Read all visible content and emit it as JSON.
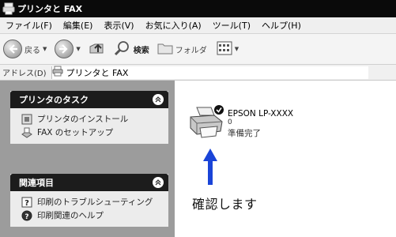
{
  "window": {
    "title": "プリンタと FAX"
  },
  "menubar": {
    "items": [
      "ファイル(F)",
      "編集(E)",
      "表示(V)",
      "お気に入り(A)",
      "ツール(T)",
      "ヘルプ(H)"
    ]
  },
  "toolbar": {
    "back_label": "戻る",
    "search_label": "検索",
    "folders_label": "フォルダ"
  },
  "address": {
    "label": "アドレス(D)",
    "value": "プリンタと FAX"
  },
  "sidebar": {
    "printer_tasks": {
      "title": "プリンタのタスク",
      "items": [
        {
          "label": "プリンタのインストール",
          "icon": "printer-install-icon"
        },
        {
          "label": "FAX のセットアップ",
          "icon": "fax-icon"
        }
      ]
    },
    "related": {
      "title": "関連項目",
      "items": [
        {
          "label": "印刷のトラブルシューティング",
          "icon": "help-question-icon"
        },
        {
          "label": "印刷関連のヘルプ",
          "icon": "help-icon"
        }
      ]
    }
  },
  "printer": {
    "name": "EPSON LP-XXXX",
    "documents": "0",
    "status": "準備完了",
    "default_badge": "check-icon"
  },
  "annotation": {
    "text": "確認します"
  },
  "colors": {
    "titlebar": "#0a0a0a",
    "sidebar_bg": "#9c9c9c",
    "panel_header": "#1c1c1c",
    "arrow": "#1a44d8"
  }
}
